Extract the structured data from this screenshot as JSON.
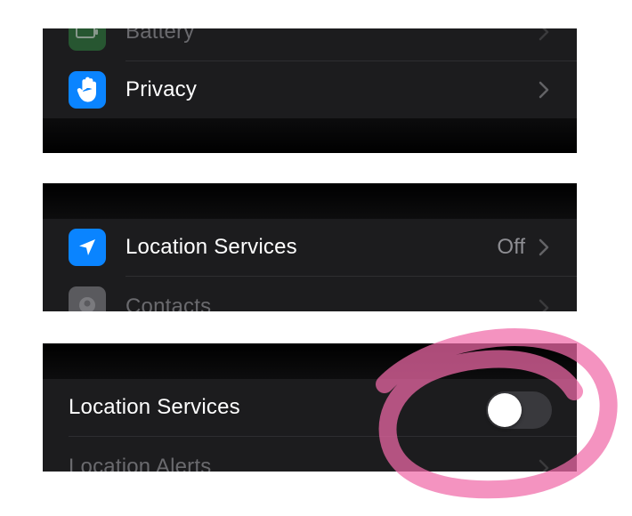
{
  "panel_1": {
    "battery_label": "Battery",
    "privacy_label": "Privacy"
  },
  "panel_2": {
    "location_services_label": "Location Services",
    "location_services_value": "Off",
    "contacts_label": "Contacts"
  },
  "panel_3": {
    "location_services_label": "Location Services",
    "location_services_toggle": "off",
    "location_alerts_label": "Location Alerts"
  },
  "icons": {
    "battery": "battery-icon",
    "privacy": "hand-raised-icon",
    "location": "location-arrow-icon",
    "contacts": "contacts-icon",
    "chevron": "chevron-right-icon"
  },
  "colors": {
    "cell_background": "#1c1c1e",
    "battery_tile": "#34c759",
    "privacy_tile": "#0a84ff",
    "location_tile": "#0a84ff",
    "contacts_tile": "#8e8e93",
    "toggle_off_track": "#39393d",
    "annotation_highlight": "#f06aa8"
  }
}
